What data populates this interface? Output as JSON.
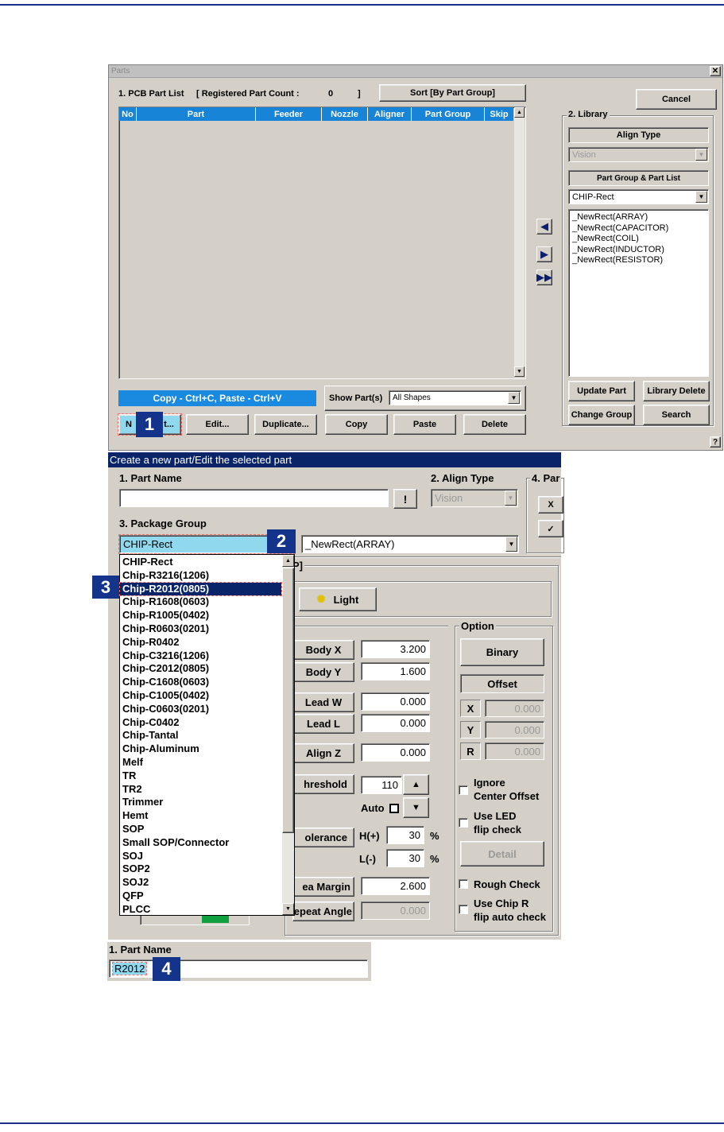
{
  "parts_window": {
    "title": "Parts",
    "pcb_list_label": "1. PCB Part List",
    "registered_label": "[ Registered Part Count :",
    "registered_count": "0",
    "registered_close": "]",
    "sort_button": "Sort [By Part Group]",
    "cancel_button": "Cancel",
    "columns": [
      "No",
      "Part",
      "Feeder",
      "Nozzle",
      "Aligner",
      "Part Group",
      "Skip"
    ],
    "copy_hint": "Copy - Ctrl+C, Paste - Ctrl+V",
    "show_parts_label": "Show Part(s)",
    "show_parts_value": "All Shapes",
    "buttons": {
      "new_prefix": "N",
      "new_suffix": "t...",
      "edit": "Edit...",
      "duplicate": "Duplicate...",
      "copy": "Copy",
      "paste": "Paste",
      "delete": "Delete"
    },
    "library": {
      "title": "2. Library",
      "align_type_label": "Align Type",
      "align_type_value": "Vision",
      "part_group_label": "Part Group & Part List",
      "part_group_value": "CHIP-Rect",
      "items": [
        "_NewRect(ARRAY)",
        "_NewRect(CAPACITOR)",
        "_NewRect(COIL)",
        "_NewRect(INDUCTOR)",
        "_NewRect(RESISTOR)"
      ],
      "update_part": "Update Part",
      "library_delete": "Library Delete",
      "change_group": "Change Group",
      "search": "Search"
    },
    "help_label": "?"
  },
  "edit_window": {
    "title": "Create a new part/Edit the selected part",
    "part_name_label": "1. Part Name",
    "part_name_value": "",
    "bang_button": "!",
    "align_type_label": "2. Align Type",
    "align_type_value": "Vision",
    "section4_label": "4. Par",
    "section4_btn1": "X",
    "section4_btn2": "✓",
    "package_group_label": "3. Package Group",
    "package_group_value": "CHIP-Rect",
    "package_part_value": "_NewRect(ARRAY)",
    "partial_group_title": "P]",
    "light_button": "Light",
    "dropdown_items": [
      "CHIP-Rect",
      "Chip-R3216(1206)",
      "Chip-R2012(0805)",
      "Chip-R1608(0603)",
      "Chip-R1005(0402)",
      "Chip-R0603(0201)",
      "Chip-R0402",
      "Chip-C3216(1206)",
      "Chip-C2012(0805)",
      "Chip-C1608(0603)",
      "Chip-C1005(0402)",
      "Chip-C0603(0201)",
      "Chip-C0402",
      "Chip-Tantal",
      "Chip-Aluminum",
      "Melf",
      "TR",
      "TR2",
      "Trimmer",
      "Hemt",
      "SOP",
      "Small SOP/Connector",
      "SOJ",
      "SOP2",
      "SOJ2",
      "QFP",
      "PLCC"
    ],
    "dropdown_selected_index": 2,
    "body_x_label": "Body X",
    "body_x_value": "3.200",
    "body_y_label": "Body Y",
    "body_y_value": "1.600",
    "lead_w_label": "Lead W",
    "lead_w_value": "0.000",
    "lead_l_label": "Lead L",
    "lead_l_value": "0.000",
    "align_z_label": "Align Z",
    "align_z_value": "0.000",
    "threshold_label": "hreshold",
    "threshold_value": "110",
    "auto_label": "Auto",
    "tolerance_label": "olerance",
    "h_label": "H(+)",
    "h_value": "30",
    "l_label": "L(-)",
    "l_value": "30",
    "percent": "%",
    "area_margin_label": "ea Margin",
    "area_margin_value": "2.600",
    "repeat_angle_label": "epeat Angle",
    "repeat_angle_value": "0.000",
    "option": {
      "title": "Option",
      "binary": "Binary",
      "offset": "Offset",
      "x_label": "X",
      "x_value": "0.000",
      "y_label": "Y",
      "y_value": "0.000",
      "r_label": "R",
      "r_value": "0.000",
      "ignore_center_1": "Ignore",
      "ignore_center_2": "Center Offset",
      "use_led_1": "Use LED",
      "use_led_2": "flip check",
      "detail": "Detail",
      "rough_check": "Rough Check",
      "use_chip_1": "Use Chip R",
      "use_chip_2": "flip auto check"
    }
  },
  "name_panel": {
    "label": "1. Part Name",
    "value": "R2012"
  },
  "badges": [
    "1",
    "2",
    "3",
    "4"
  ],
  "colors": {
    "title_blue": "#0a246a",
    "header_blue": "#1884d8",
    "hint_blue": "#1a8ae0",
    "badge_navy": "#14338a",
    "highlight_cyan": "#8fd8ee",
    "rule_navy": "#1b2f8a"
  }
}
